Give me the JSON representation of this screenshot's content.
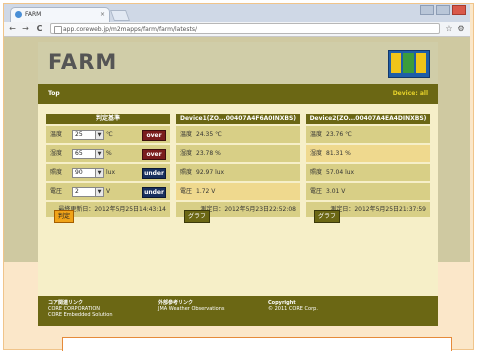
{
  "browser": {
    "tab_title": "FARM",
    "tab_close": "×",
    "url": "app.coreweb.jp/m2mapps/farm/farm/latests/",
    "back": "←",
    "forward": "→",
    "reload": "C"
  },
  "header": {
    "logo": "FARM"
  },
  "nav": {
    "top": "Top",
    "device": "Device: all"
  },
  "panels": {
    "criteria": {
      "title": "判定基準",
      "rows": [
        {
          "label": "温度",
          "value": "25",
          "unit": "℃",
          "status": "over"
        },
        {
          "label": "湿度",
          "value": "65",
          "unit": "%",
          "status": "over"
        },
        {
          "label": "照度",
          "value": "90",
          "unit": "lux",
          "status": "under"
        },
        {
          "label": "電圧",
          "value": "2",
          "unit": "V",
          "status": "under"
        }
      ],
      "updated": "最終更新日：2012年5月25日14:43:14",
      "button": "判定"
    },
    "device1": {
      "title": "Device1(ZO...00407A4F6A0INXBS)",
      "rows": [
        {
          "label": "温度",
          "value": "24.35 ℃"
        },
        {
          "label": "湿度",
          "value": "23.78 %"
        },
        {
          "label": "照度",
          "value": "92.97 lux"
        },
        {
          "label": "電圧",
          "value": "1.72 V"
        }
      ],
      "measured": "測定日：2012年5月23日22:52:08",
      "button": "グラフ"
    },
    "device2": {
      "title": "Device2(ZO...00407A4EA4DINXBS)",
      "rows": [
        {
          "label": "温度",
          "value": "23.76 ℃"
        },
        {
          "label": "湿度",
          "value": "81.31 %"
        },
        {
          "label": "照度",
          "value": "57.04 lux"
        },
        {
          "label": "電圧",
          "value": "3.01 V"
        }
      ],
      "measured": "測定日：2012年5月25日21:37:59",
      "button": "グラフ"
    }
  },
  "footer": {
    "col1_title": "コア関連リンク",
    "col1_line1": "CORE CORPORATION",
    "col1_line2": "CORE Embedded Solution",
    "col2_title": "外部参考リンク",
    "col2_line1": "JMA Weather Observations",
    "col3_title": "Copyright",
    "col3_line1": "© 2011 CORE Corp."
  }
}
